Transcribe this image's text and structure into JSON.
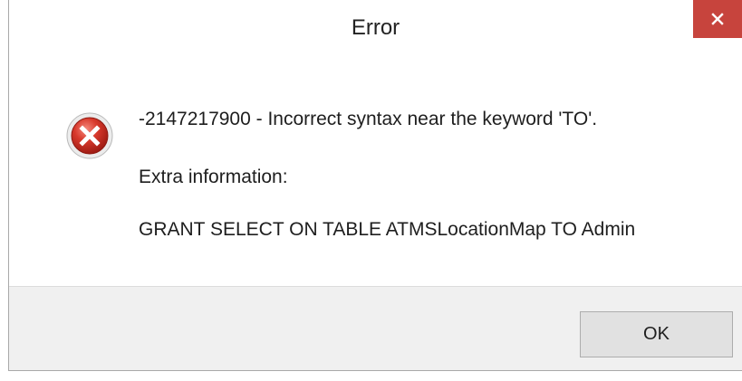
{
  "dialog": {
    "title": "Error",
    "close_icon": "close-icon",
    "close_color": "#c7443d",
    "error_icon": "error-icon",
    "error_icon_color": "#c62828",
    "message": "-2147217900 - Incorrect syntax near the keyword 'TO'.",
    "extra_label": "Extra information:",
    "extra_detail": "GRANT SELECT ON TABLE ATMSLocationMap TO Admin",
    "ok_label": "OK"
  }
}
